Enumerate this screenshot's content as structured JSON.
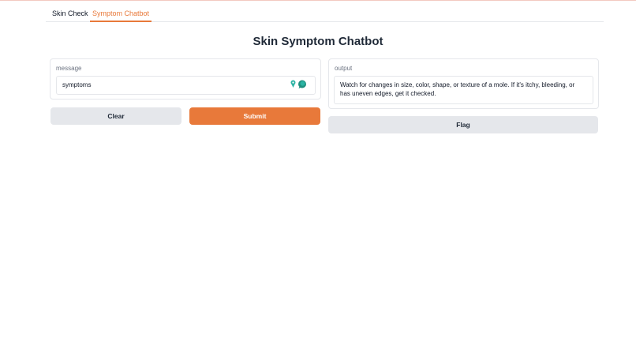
{
  "tabs": [
    {
      "label": "Skin Check",
      "active": false
    },
    {
      "label": "Symptom Chatbot",
      "active": true
    }
  ],
  "title": "Skin Symptom Chatbot",
  "input_panel": {
    "label": "message",
    "value": "symptoms",
    "icons": [
      "location-pin-icon",
      "chat-bubble-icon"
    ]
  },
  "output_panel": {
    "label": "output",
    "text": "Watch for changes in size, color, shape, or texture of a mole. If it's itchy, bleeding, or has uneven edges, get it checked."
  },
  "buttons": {
    "clear": "Clear",
    "submit": "Submit",
    "flag": "Flag"
  },
  "colors": {
    "accent": "#e8793a",
    "button_gray": "#e5e7eb",
    "icon_teal": "#2bb3a3"
  }
}
